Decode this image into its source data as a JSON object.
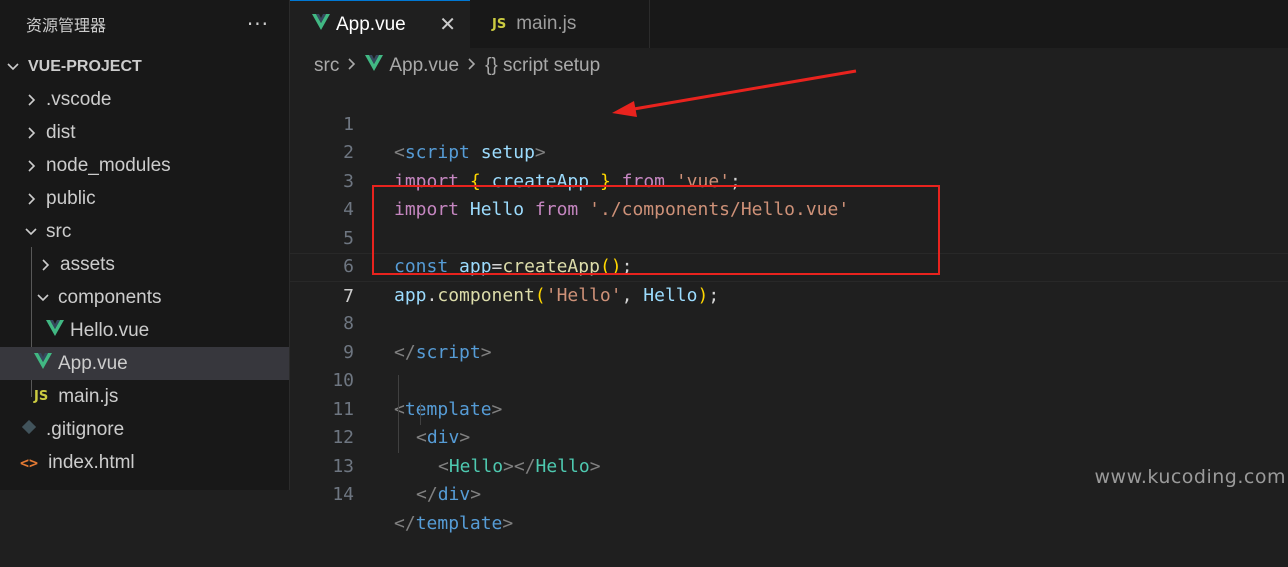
{
  "explorer": {
    "title": "资源管理器",
    "more": "···",
    "items": [
      {
        "label": "VUE-PROJECT",
        "icon": "chevron-down-icon"
      },
      {
        "label": ".vscode",
        "icon": "chevron-right-icon"
      },
      {
        "label": "dist",
        "icon": "chevron-right-icon"
      },
      {
        "label": "node_modules",
        "icon": "chevron-right-icon"
      },
      {
        "label": "public",
        "icon": "chevron-right-icon"
      },
      {
        "label": "src",
        "icon": "chevron-down-icon"
      },
      {
        "label": "assets",
        "icon": "chevron-right-icon"
      },
      {
        "label": "components",
        "icon": "chevron-down-icon"
      },
      {
        "label": "Hello.vue",
        "icon": "vue-file-icon"
      },
      {
        "label": "App.vue",
        "icon": "vue-file-icon"
      },
      {
        "label": "main.js",
        "icon": "js-file-icon"
      },
      {
        "label": ".gitignore",
        "icon": "git-icon"
      },
      {
        "label": "index.html",
        "icon": "html-file-icon"
      }
    ],
    "js_badge": "JS",
    "html_badge": "<>"
  },
  "tabs": [
    {
      "label": "App.vue",
      "icon": "vue-file-icon",
      "close": "✕"
    },
    {
      "label": "main.js",
      "icon": "js-file-icon"
    }
  ],
  "breadcrumb": {
    "src": "src",
    "file": "App.vue",
    "symbol": "{} script setup"
  },
  "code": {
    "line_numbers": [
      "1",
      "2",
      "3",
      "4",
      "5",
      "6",
      "7",
      "8",
      "9",
      "10",
      "11",
      "12",
      "13",
      "14"
    ],
    "l1": {
      "open": "<",
      "tag": "script",
      "attr": "setup",
      "close": ">"
    },
    "l2": {
      "import": "import",
      "lb": "{",
      "name": "createApp",
      "rb": "}",
      "from": "from",
      "str": "'vue'",
      "semi": ";"
    },
    "l3": {
      "import": "import",
      "name": "Hello",
      "from": "from",
      "str": "'./components/Hello.vue'"
    },
    "l5": {
      "const": "const",
      "var": "app",
      "eq": "=",
      "fn": "createApp",
      "parens": "()",
      "semi": ";"
    },
    "l6": {
      "var": "app",
      "dot": ".",
      "fn": "component",
      "lp": "(",
      "str": "'Hello'",
      "comma": ", ",
      "arg": "Hello",
      "rp": ")",
      "semi": ";"
    },
    "l8": {
      "open": "</",
      "tag": "script",
      "close": ">"
    },
    "l10": {
      "open": "<",
      "tag": "template",
      "close": ">"
    },
    "l11": {
      "open": "<",
      "tag": "div",
      "close": ">"
    },
    "l12": {
      "open": "<",
      "tag": "Hello",
      "mid": "></",
      "tag2": "Hello",
      "close": ">"
    },
    "l13": {
      "open": "</",
      "tag": "div",
      "close": ">"
    },
    "l14": {
      "open": "</",
      "tag": "template",
      "close": ">"
    }
  },
  "annotation_color": "#e8231e",
  "watermark": "www.kucoding.com"
}
